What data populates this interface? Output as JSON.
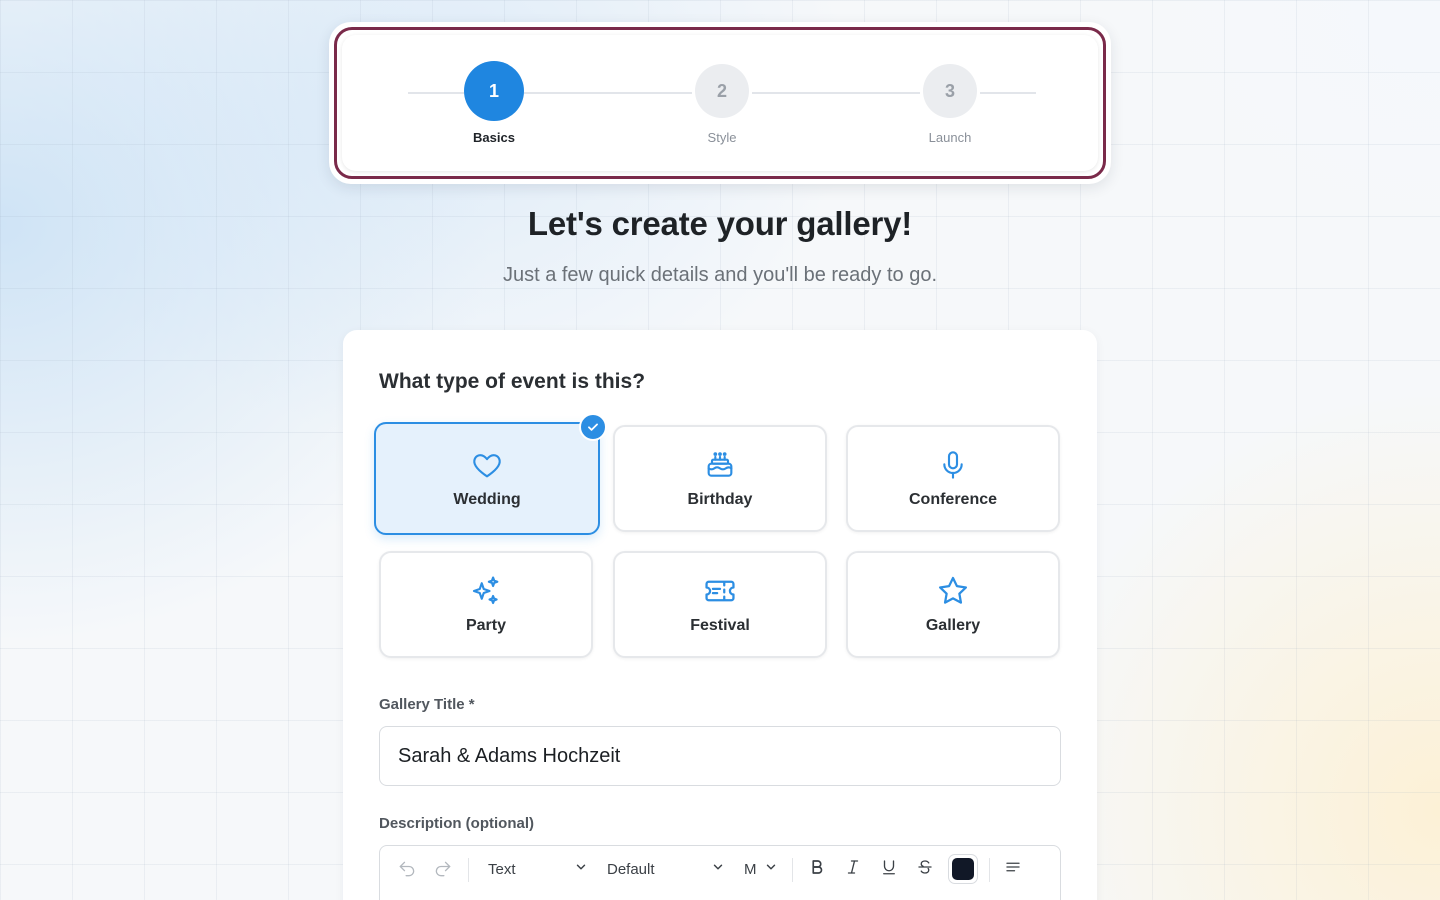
{
  "stepper": {
    "steps": [
      {
        "number": "1",
        "label": "Basics",
        "state": "active"
      },
      {
        "number": "2",
        "label": "Style",
        "state": "inactive"
      },
      {
        "number": "3",
        "label": "Launch",
        "state": "inactive"
      }
    ]
  },
  "header": {
    "title": "Let's create your gallery!",
    "subtitle": "Just a few quick details and you'll be ready to go."
  },
  "event_type": {
    "question": "What type of event is this?",
    "options": [
      {
        "label": "Wedding",
        "icon": "heart-icon",
        "selected": true
      },
      {
        "label": "Birthday",
        "icon": "cake-icon",
        "selected": false
      },
      {
        "label": "Conference",
        "icon": "microphone-icon",
        "selected": false
      },
      {
        "label": "Party",
        "icon": "sparkles-icon",
        "selected": false
      },
      {
        "label": "Festival",
        "icon": "ticket-icon",
        "selected": false
      },
      {
        "label": "Gallery",
        "icon": "star-icon",
        "selected": false
      }
    ]
  },
  "gallery_title": {
    "label": "Gallery Title *",
    "value": "Sarah & Adams Hochzeit"
  },
  "description": {
    "label": "Description (optional)",
    "toolbar": {
      "block_type": "Text",
      "font": "Default",
      "size": "M",
      "text_color": "#111827"
    }
  },
  "colors": {
    "accent": "#1f86e0",
    "stepper_border": "#7a2a4a",
    "icon": "#2c8ee3"
  }
}
